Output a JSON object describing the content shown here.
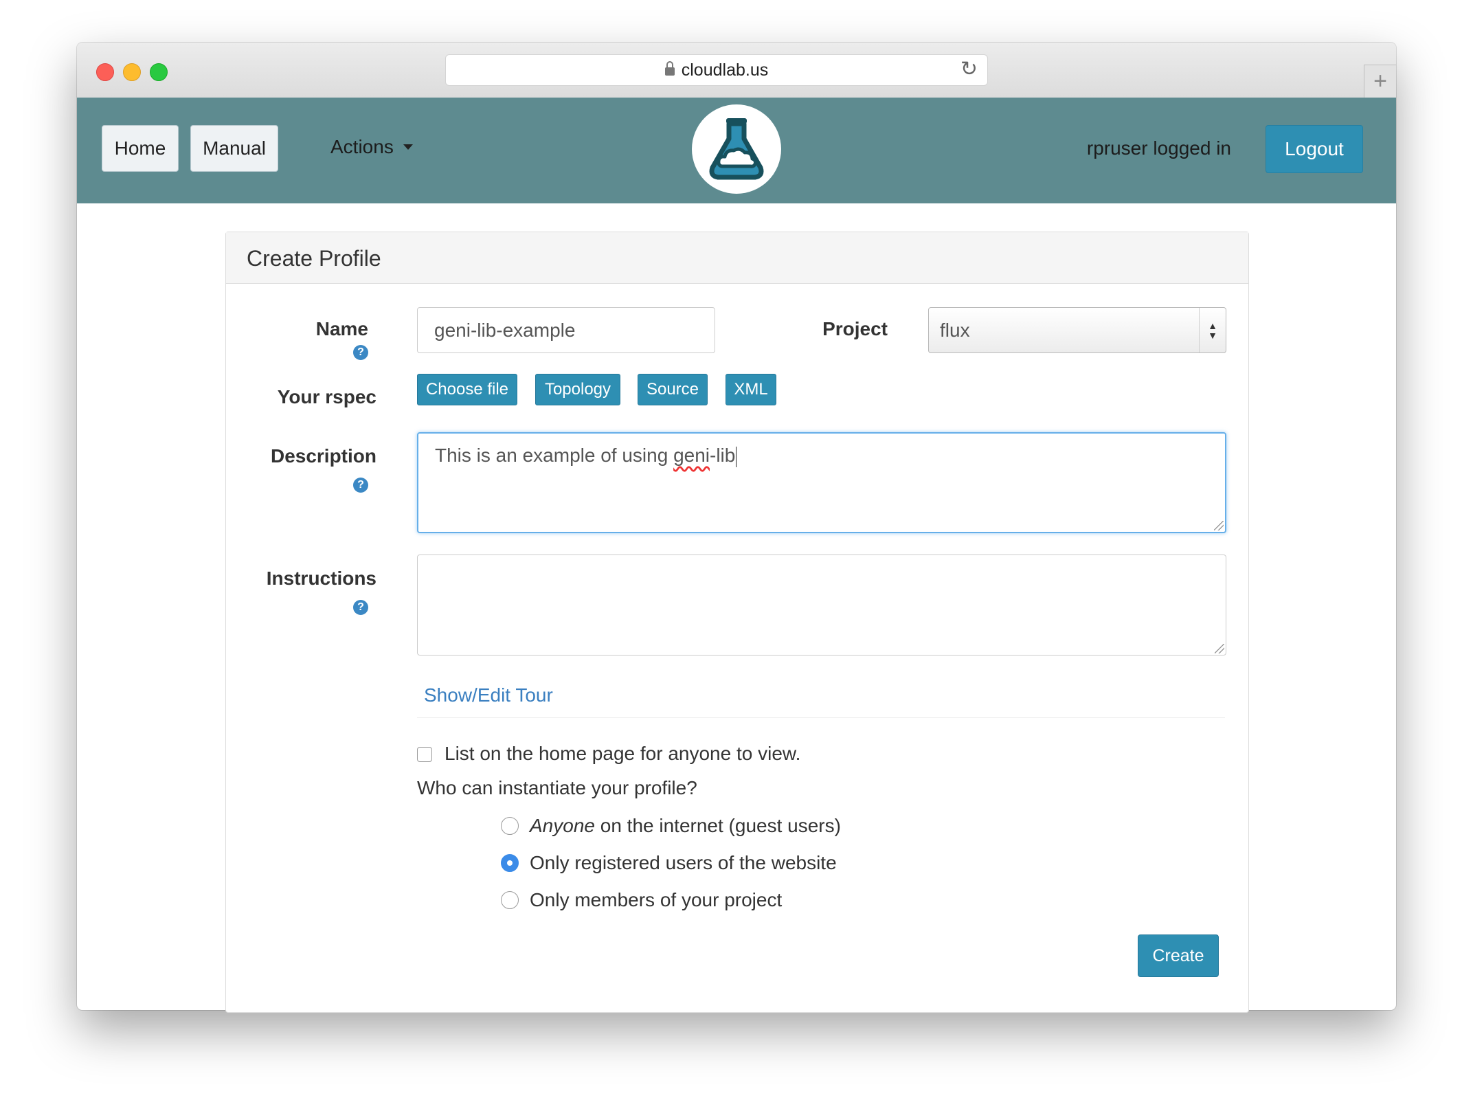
{
  "browser": {
    "url": "cloudlab.us"
  },
  "navbar": {
    "home_label": "Home",
    "manual_label": "Manual",
    "actions_label": "Actions",
    "login_status": "rpruser logged in",
    "logout_label": "Logout"
  },
  "panel": {
    "title": "Create Profile"
  },
  "form": {
    "name_label": "Name",
    "name_value": "geni-lib-example",
    "project_label": "Project",
    "project_value": "flux",
    "rspec_label": "Your rspec",
    "rspec_buttons": [
      "Choose file",
      "Topology",
      "Source",
      "XML"
    ],
    "description_label": "Description",
    "description_value_prefix": "This is an example of using ",
    "description_value_misspelled": "geni",
    "description_value_suffix": "-lib",
    "instructions_label": "Instructions",
    "instructions_value": "",
    "tour_link": "Show/Edit Tour",
    "list_on_home_label": "List on the home page for anyone to view.",
    "who_label": "Who can instantiate your profile?",
    "radio_anyone_em": "Anyone",
    "radio_anyone_rest": " on the internet (guest users)",
    "radio_registered": "Only registered users of the website",
    "radio_members": "Only members of your project",
    "selected_option": "Only registered users of the website",
    "create_label": "Create"
  },
  "colors": {
    "navbar_bg": "#5e8b90",
    "primary_button": "#2e8fb3",
    "link": "#3a7fc0",
    "radio_checked": "#3b8be8"
  },
  "icons": [
    "lock-icon",
    "reload-icon",
    "new-tab-icon",
    "caret-down-icon",
    "flask-cloud-logo",
    "help-icon",
    "resize-handle-icon"
  ]
}
